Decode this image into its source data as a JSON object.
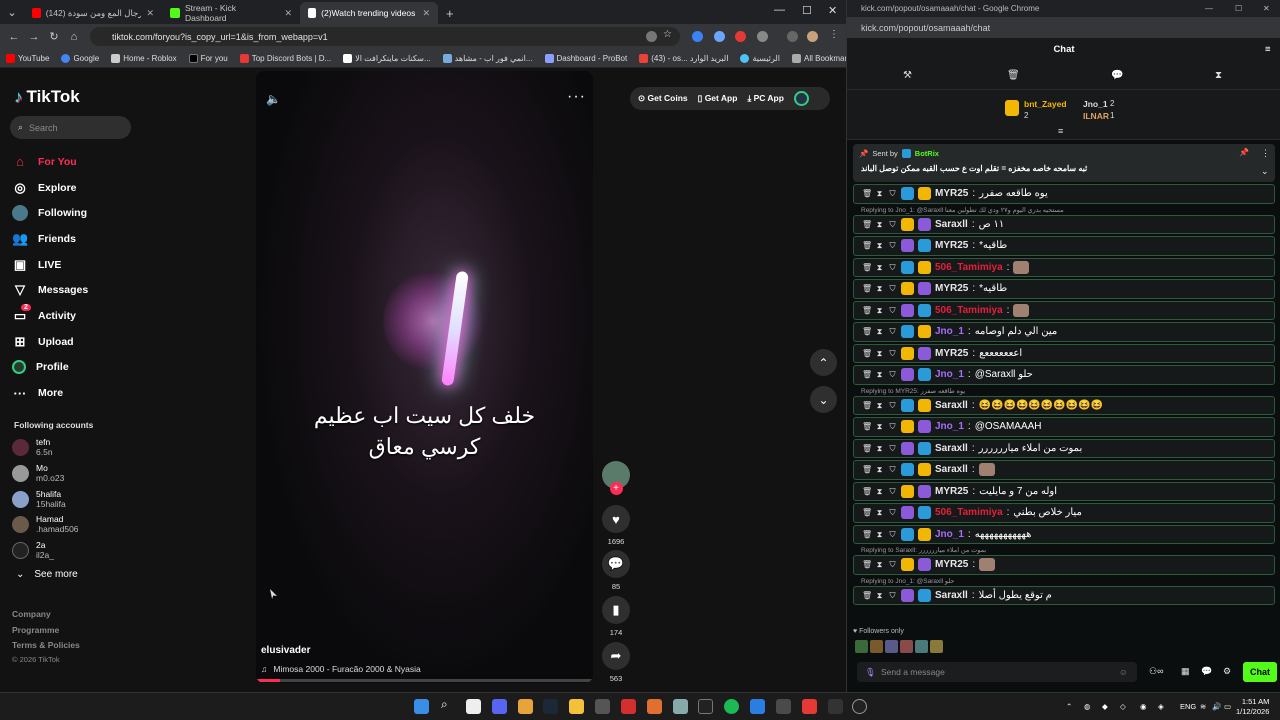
{
  "chrome": {
    "tabs": [
      {
        "label": "(142) من رجال المع ومن سودة",
        "favicon_color": "#ff0000"
      },
      {
        "label": "Stream - Kick Dashboard",
        "favicon_color": "#53fc18"
      },
      {
        "label": "(2)Watch trending videos for yo",
        "favicon_color": "#ffffff"
      }
    ],
    "url": "tiktok.com/foryou?is_copy_url=1&is_from_webapp=v1",
    "bookmarks": [
      "YouTube",
      "Google",
      "Home - Roblox",
      "For you",
      "Top Discord Bots | D...",
      "سكنات ماينكرافت الا...",
      "انمي فور اب - مشاهد...",
      "Dashboard - ProBot",
      "(43) - os... البريد الوارد",
      "الرئيسية"
    ],
    "all_bookmarks": "All Bookmarks"
  },
  "tiktok": {
    "logo": "TikTok",
    "search_placeholder": "Search",
    "nav": [
      {
        "label": "For You",
        "icon": "home-icon"
      },
      {
        "label": "Explore",
        "icon": "compass-icon"
      },
      {
        "label": "Following",
        "icon": "following-icon"
      },
      {
        "label": "Friends",
        "icon": "friends-icon"
      },
      {
        "label": "LIVE",
        "icon": "live-icon"
      },
      {
        "label": "Messages",
        "icon": "messages-icon"
      },
      {
        "label": "Activity",
        "icon": "activity-icon"
      },
      {
        "label": "Upload",
        "icon": "upload-icon"
      },
      {
        "label": "Profile",
        "icon": "profile-icon"
      },
      {
        "label": "More",
        "icon": "more-icon"
      }
    ],
    "activity_badge": "2",
    "following_title": "Following accounts",
    "following": [
      {
        "name": "tefn",
        "handle": "6.5n"
      },
      {
        "name": "Mo",
        "handle": "m0.o23"
      },
      {
        "name": "5halifa",
        "handle": "15halifa"
      },
      {
        "name": "Hamad",
        "handle": ".hamad506"
      },
      {
        "name": "2a",
        "handle": "il2a_"
      }
    ],
    "see_more": "See more",
    "footer": [
      "Company",
      "Programme",
      "Terms & Policies",
      "© 2026 TikTok"
    ],
    "top_actions": [
      "Get Coins",
      "Get App",
      "PC App"
    ],
    "video": {
      "caption_line1": "خلف كل سيت اب عظيم",
      "caption_line2": "كرسي معاق",
      "username": "elusivader",
      "music": "Mimosa 2000 - Furacão 2000 & Nyasia",
      "progress": 0.07
    },
    "actions": {
      "likes": "1696",
      "comments": "85",
      "saves": "174",
      "shares": "563"
    }
  },
  "kick": {
    "window_title": "kick.com/popout/osamaaah/chat - Google Chrome",
    "url": "kick.com/popout/osamaaah/chat",
    "chat_title": "Chat",
    "leaderboard": [
      {
        "name": "bnt_Zayed",
        "count": "2"
      },
      {
        "name": "Jno_1",
        "count": "2"
      },
      {
        "name": "ILNAR",
        "count": "1"
      }
    ],
    "pinned": {
      "sent_by_label": "Sent by",
      "sender": "BotRix",
      "text": "ثبه سامحه خاصه مخفزه = تقلم اوت ع حسب القبه ممكن توصل الباند"
    },
    "messages": [
      {
        "reply": "",
        "user": "MYR25",
        "color": "#e8e8e8",
        "text": "يوه طاقعه صفرر"
      },
      {
        "reply": "Replying to Jno_1: @Saraxll مستحيه بدري اليوم و٢٧ ودي لك تطولين معنا",
        "user": "Saraxll",
        "color": "#e8e8e8",
        "text": "١١ ص"
      },
      {
        "reply": "",
        "user": "MYR25",
        "color": "#e8e8e8",
        "text": "*طاقيه"
      },
      {
        "reply": "",
        "user": "506_Tamimiya",
        "color": "#e2203a",
        "text": ""
      },
      {
        "reply": "",
        "user": "MYR25",
        "color": "#e8e8e8",
        "text": "*طاقيه"
      },
      {
        "reply": "",
        "user": "506_Tamimiya",
        "color": "#e2203a",
        "text": ""
      },
      {
        "reply": "",
        "user": "Jno_1",
        "color": "#a56ef7",
        "text": "مين الي دلم اوصامه"
      },
      {
        "reply": "",
        "user": "MYR25",
        "color": "#e8e8e8",
        "text": "اعععععععع"
      },
      {
        "reply": "",
        "user": "Jno_1",
        "color": "#a56ef7",
        "text": "@Saraxll حلو"
      },
      {
        "reply": "Replying to MYR25: يوه طاقعه صفرر",
        "user": "Saraxll",
        "color": "#e8e8e8",
        "text": "😆😆😆😆😆😆😆😆😆😆"
      },
      {
        "reply": "",
        "user": "Jno_1",
        "color": "#a56ef7",
        "text": "@OSAMAAAH"
      },
      {
        "reply": "",
        "user": "Saraxll",
        "color": "#e8e8e8",
        "text": "بموت من املاء ميارررررر"
      },
      {
        "reply": "",
        "user": "Saraxll",
        "color": "#e8e8e8",
        "text": ""
      },
      {
        "reply": "",
        "user": "MYR25",
        "color": "#e8e8e8",
        "text": "اوله من 7 و مايليت"
      },
      {
        "reply": "",
        "user": "506_Tamimiya",
        "color": "#e2203a",
        "text": "ميار خلاص بطني"
      },
      {
        "reply": "",
        "user": "Jno_1",
        "color": "#a56ef7",
        "text": "هههههههههههه"
      },
      {
        "reply": "Replying to Saraxll: بموت من املاء ميارررررر",
        "user": "MYR25",
        "color": "#e8e8e8",
        "text": ""
      },
      {
        "reply": "Replying to Jno_1: @Saraxll حلو",
        "user": "Saraxll",
        "color": "#e8e8e8",
        "text": "م توقع يطول أصلا"
      }
    ],
    "followers_only": "Followers only",
    "send_placeholder": "Send a message",
    "chat_button": "Chat"
  },
  "taskbar": {
    "lang": "ENG",
    "time": "1:51 AM",
    "date": "1/12/2026"
  }
}
